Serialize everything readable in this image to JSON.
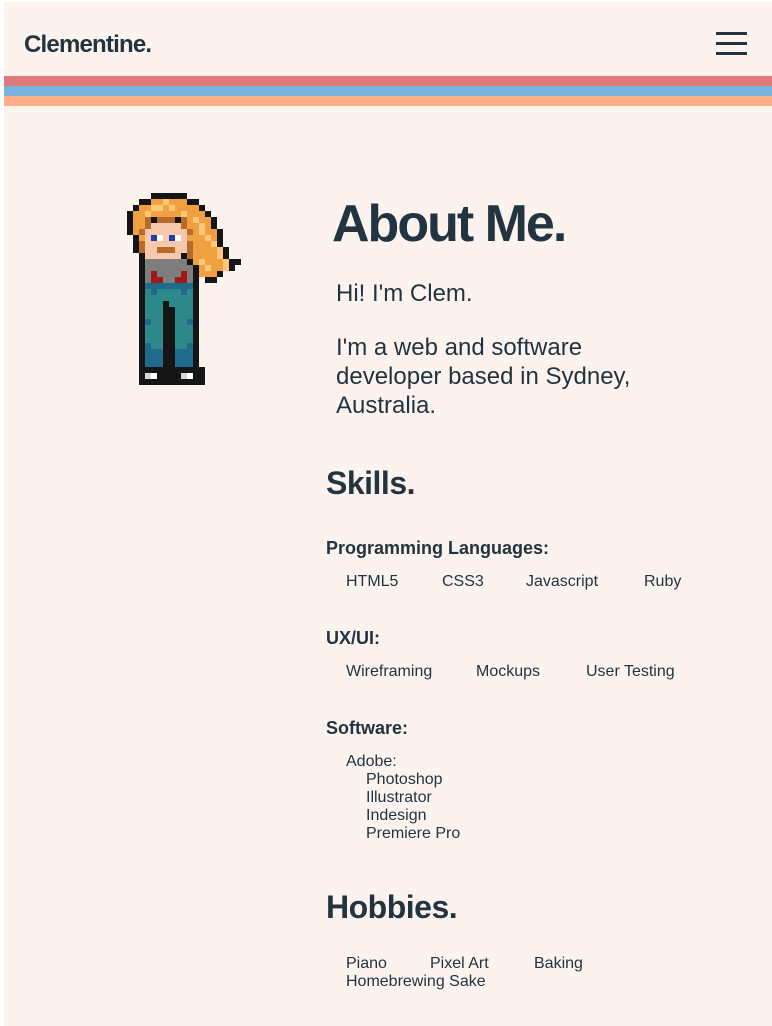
{
  "header": {
    "brand": "Clementine.",
    "menu_icon": "hamburger-menu-icon",
    "stripe_colors": [
      "#e07a7a",
      "#7ab4de",
      "#ffae88"
    ]
  },
  "about": {
    "title": "About Me.",
    "intro": "Hi! I'm Clem.",
    "bio": "I'm a web and software developer based in Sydney, Australia."
  },
  "skills": {
    "title": "Skills.",
    "groups": [
      {
        "label": "Programming Languages:",
        "items": [
          "HTML5",
          "CSS3",
          "Javascript",
          "Ruby"
        ]
      },
      {
        "label": "UX/UI:",
        "items": [
          "Wireframing",
          "Mockups",
          "User Testing"
        ]
      },
      {
        "label": "Software:",
        "parent": "Adobe:",
        "items": [
          "Photoshop",
          "Illustrator",
          "Indesign",
          "Premiere Pro"
        ]
      }
    ]
  },
  "hobbies": {
    "title": "Hobbies.",
    "items": [
      "Piano",
      "Pixel Art",
      "Baking",
      "Homebrewing Sake"
    ]
  },
  "colors": {
    "background": "#fcf3ef",
    "text": "#22343f"
  }
}
